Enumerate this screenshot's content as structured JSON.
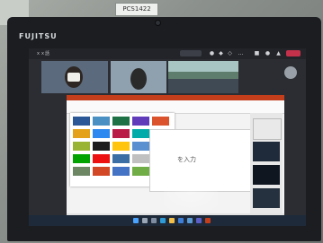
{
  "scene": {
    "sticker_label": "PCS1422",
    "laptop_brand": "FUJITSU",
    "title_bar_text": "ｘｘ話",
    "colors": {
      "teams_bar": "#232429",
      "leave_button": "#c4314b",
      "ppt_accent": "#c43e1c",
      "taskbar": "#1e2a3a"
    }
  },
  "teams": {
    "avatar_initials": "",
    "video_tiles": [
      {
        "name": "participant-1"
      },
      {
        "name": "participant-2"
      },
      {
        "name": "classroom-view"
      }
    ]
  },
  "powerpoint": {
    "slide_placeholder": "を入力",
    "gallery_thumbnail_count": 25,
    "design_ideas_count": 4
  },
  "taskbar": {
    "icons": [
      "start-icon",
      "search-icon",
      "task-view-icon",
      "edge-icon",
      "explorer-icon",
      "store-icon",
      "mail-icon",
      "teams-icon",
      "powerpoint-icon"
    ]
  }
}
